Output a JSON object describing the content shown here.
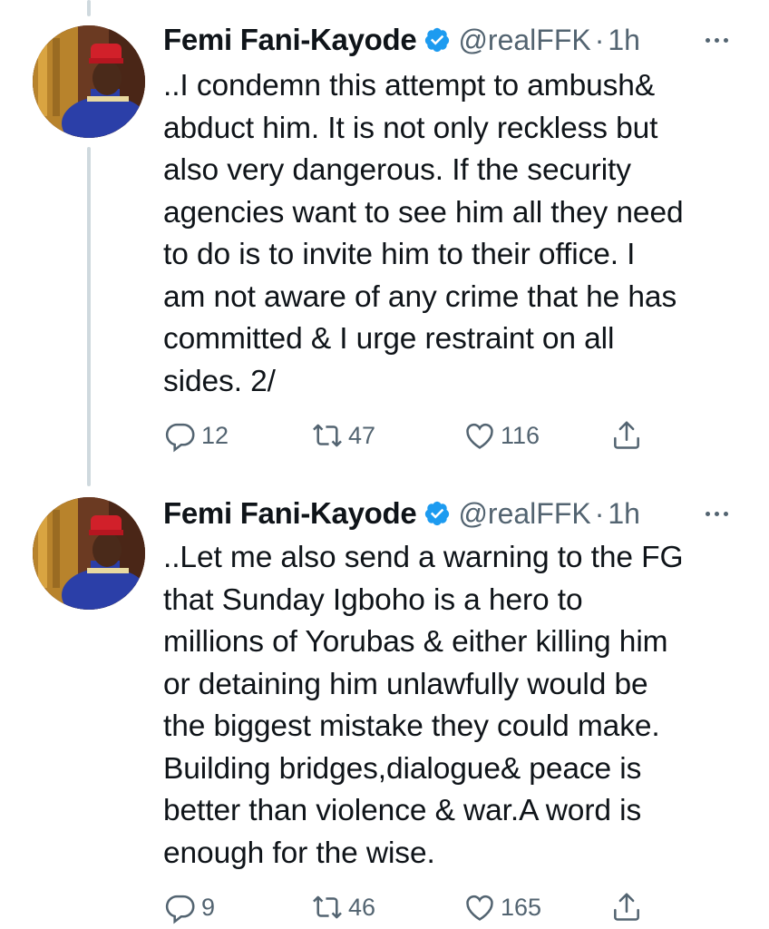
{
  "tweets": [
    {
      "name": "Femi Fani-Kayode",
      "handle": "@realFFK",
      "separator": "·",
      "time": "1h",
      "text": "..I condemn this attempt to ambush&\nabduct him. It is not only reckless but\nalso very dangerous. If the security\nagencies want to see him all they need\nto do is to invite him to their office. I\nam not aware of any crime that he has\ncommitted & I urge restraint on all\nsides. 2/",
      "replies": "12",
      "retweets": "47",
      "likes": "116"
    },
    {
      "name": "Femi Fani-Kayode",
      "handle": "@realFFK",
      "separator": "·",
      "time": "1h",
      "text": "..Let me also send a warning to the FG\nthat Sunday Igboho is a hero to\nmillions of Yorubas & either killing him\nor detaining him unlawfully would be\nthe biggest mistake they could make.\nBuilding bridges,dialogue& peace is\nbetter than violence & war.A word is\nenough for the wise.",
      "replies": "9",
      "retweets": "46",
      "likes": "165"
    }
  ],
  "icons": {
    "verified": "verified-badge-icon",
    "more": "more-icon",
    "reply": "reply-icon",
    "retweet": "retweet-icon",
    "like": "like-icon",
    "share": "share-icon"
  },
  "colors": {
    "verified": "#1d9bf0",
    "secondary_text": "#536471",
    "thread_line": "#cfd9de"
  }
}
